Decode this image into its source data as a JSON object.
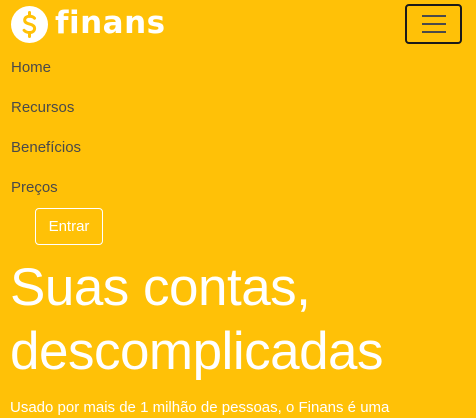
{
  "brand": {
    "name": "finans",
    "icon": "dollar-coin-icon"
  },
  "navbar": {
    "toggler_icon": "hamburger-menu-icon",
    "items": [
      {
        "label": "Home"
      },
      {
        "label": "Recursos"
      },
      {
        "label": "Benefícios"
      },
      {
        "label": "Preços"
      }
    ],
    "login_label": "Entrar"
  },
  "hero": {
    "title_line1": "Suas contas,",
    "title_line2": "descomplicadas",
    "subtitle": "Usado por mais de 1 milhão de pessoas, o Finans é uma"
  },
  "colors": {
    "background": "#ffc107",
    "text_light": "#ffffff",
    "nav_text": "#4a4a4a",
    "toggler_border": "#1a1a1a"
  }
}
